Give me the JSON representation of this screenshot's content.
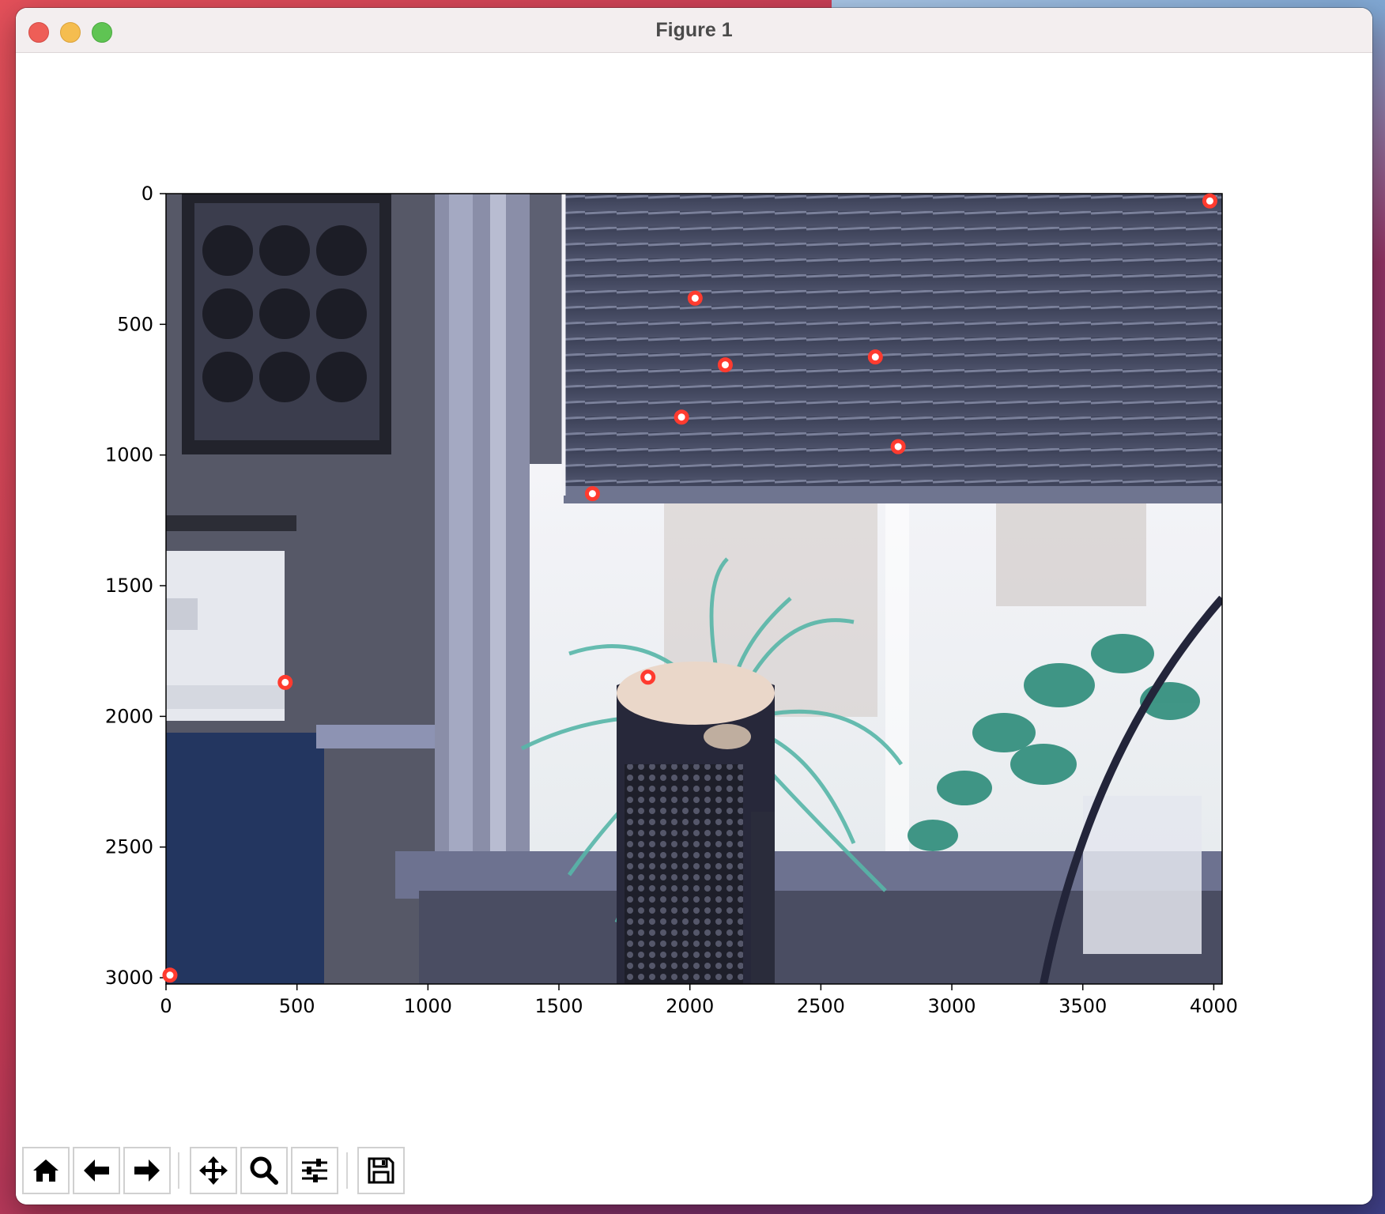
{
  "window": {
    "title": "Figure 1"
  },
  "toolbar": {
    "buttons": [
      {
        "name": "home",
        "icon": "home-icon"
      },
      {
        "name": "back",
        "icon": "arrow-left-icon"
      },
      {
        "name": "forward",
        "icon": "arrow-right-icon"
      },
      {
        "name": "pan",
        "icon": "move-icon"
      },
      {
        "name": "zoom",
        "icon": "search-icon"
      },
      {
        "name": "configure-subplots",
        "icon": "sliders-icon"
      },
      {
        "name": "save",
        "icon": "floppy-disk-icon"
      }
    ]
  },
  "chart_data": {
    "type": "scatter",
    "background": "photograph (color-inverted room scene: window blinds, plants, air purifier, printer)",
    "marker_color": "#ff3b2f",
    "x_ticks": [
      "0",
      "500",
      "1000",
      "1500",
      "2000",
      "2500",
      "3000",
      "3500",
      "4000"
    ],
    "y_ticks": [
      "0",
      "500",
      "1000",
      "1500",
      "2000",
      "2500",
      "3000"
    ],
    "xlim": [
      0,
      4032
    ],
    "ylim": [
      3024,
      0
    ],
    "points": [
      {
        "x": 3985,
        "y": 28
      },
      {
        "x": 2020,
        "y": 400
      },
      {
        "x": 2135,
        "y": 655
      },
      {
        "x": 2708,
        "y": 625
      },
      {
        "x": 1968,
        "y": 855
      },
      {
        "x": 2795,
        "y": 968
      },
      {
        "x": 1628,
        "y": 1148
      },
      {
        "x": 1840,
        "y": 1850
      },
      {
        "x": 455,
        "y": 1870
      },
      {
        "x": 15,
        "y": 2990
      }
    ]
  }
}
